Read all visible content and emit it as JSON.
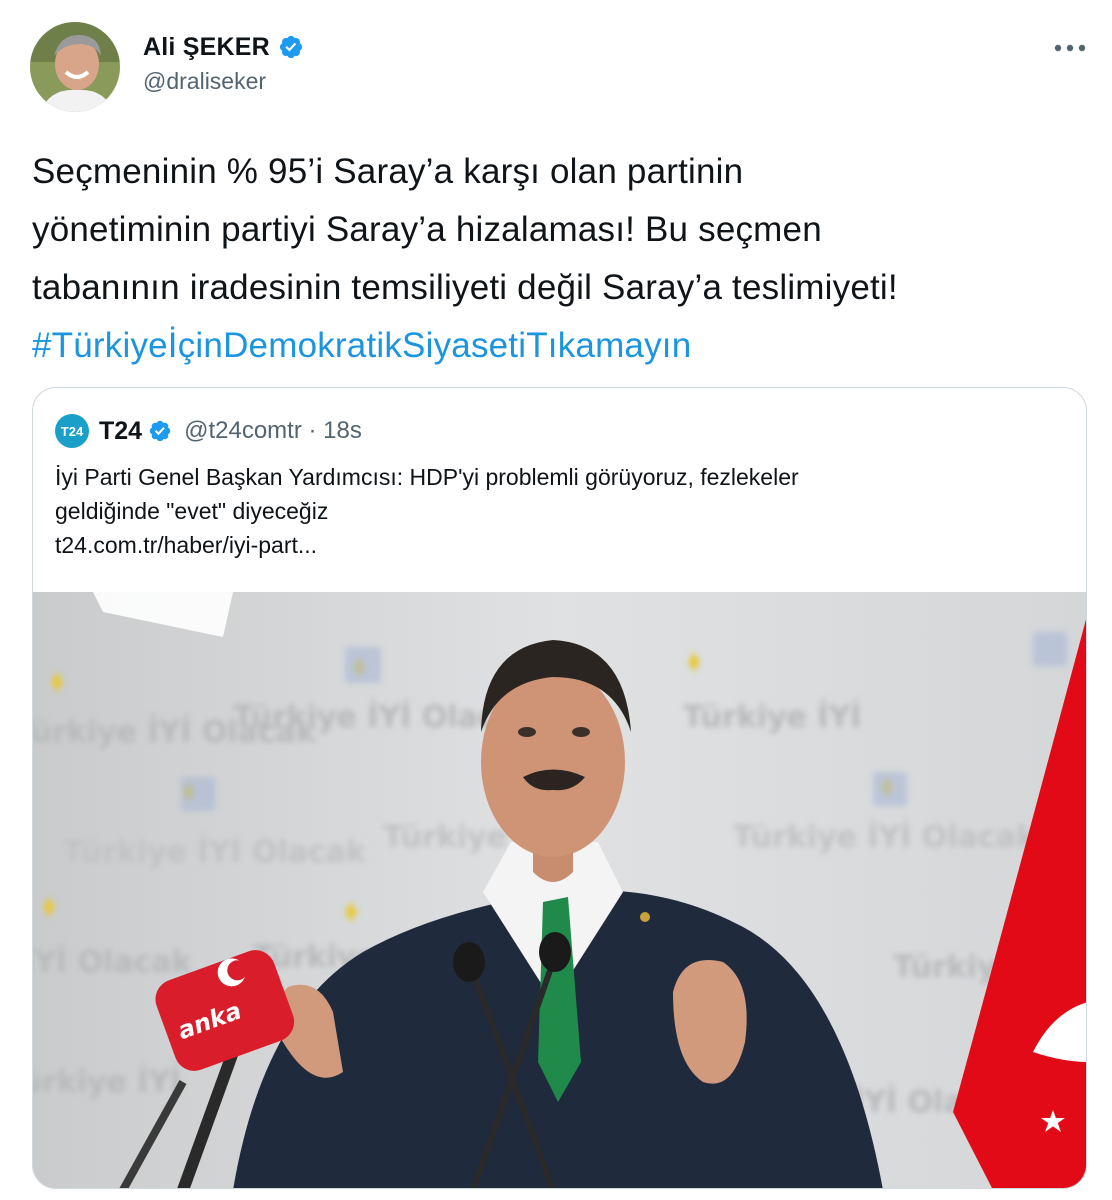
{
  "author": {
    "display_name": "Ali ŞEKER",
    "handle": "@draliseker",
    "verified": true
  },
  "tweet": {
    "text_lines": [
      "Seçmeninin % 95’i Saray’a karşı olan partinin",
      "yönetiminin partiyi Saray’a hizalaması! Bu seçmen",
      "tabanının iradesinin temsiliyeti değil Saray’a teslimiyeti!"
    ],
    "hashtag": "#TürkiyeİçinDemokratikSiyasetiTıkamayın"
  },
  "quote": {
    "logo_text": "T24",
    "name": "T24",
    "meta": "@t24comtr · 18s",
    "text_lines": [
      "İyi Parti Genel Başkan Yardımcısı: HDP'yi problemli görüyoruz, fezlekeler",
      "geldiğinde \"evet\" diyeceğiz"
    ],
    "link": "t24.com.tr/haber/iyi-part..."
  },
  "media": {
    "microphone_brand": "anka",
    "background_text": "Türkiye İYİ Olacak"
  },
  "colors": {
    "accent": "#1b95e0",
    "verified": "#1d9bf0",
    "secondary_text": "#536471",
    "border": "#cfd9de",
    "flag_red": "#e30a17"
  },
  "icons": {
    "verified": "verified-badge-icon",
    "more": "more-horizontal-icon"
  }
}
